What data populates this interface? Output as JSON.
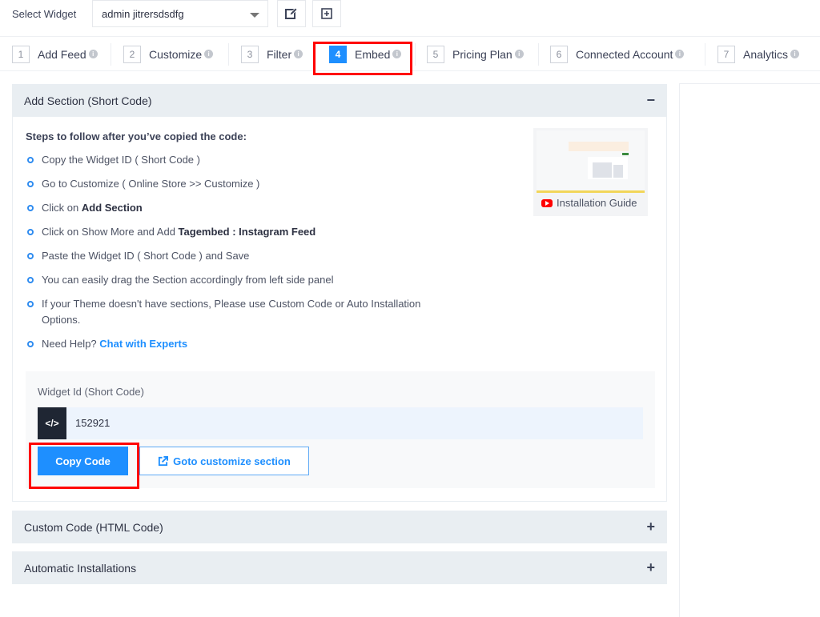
{
  "topbar": {
    "label": "Select Widget",
    "selected_widget": "admin jitrersdsdfg",
    "edit_icon": "edit-icon",
    "add_icon": "plus-square-icon"
  },
  "tabs": [
    {
      "num": "1",
      "label": "Add Feed",
      "active": false
    },
    {
      "num": "2",
      "label": "Customize",
      "active": false
    },
    {
      "num": "3",
      "label": "Filter",
      "active": false
    },
    {
      "num": "4",
      "label": "Embed",
      "active": true
    },
    {
      "num": "5",
      "label": "Pricing Plan",
      "active": false
    },
    {
      "num": "6",
      "label": "Connected Account",
      "active": false
    },
    {
      "num": "7",
      "label": "Analytics",
      "active": false
    }
  ],
  "info_glyph": "i",
  "sections": {
    "add_section": {
      "title": "Add Section (Short Code)",
      "toggle": "−",
      "steps_title": "Steps to follow after you’ve copied the code:",
      "steps": [
        {
          "text": "Copy the Widget ID ( Short Code )"
        },
        {
          "text": "Go to Customize ( Online Store >> Customize )"
        },
        {
          "pre": "Click on ",
          "bold": "Add Section"
        },
        {
          "pre": "Click on Show More and Add ",
          "bold": "Tagembed : Instagram Feed"
        },
        {
          "text": "Paste the Widget ID ( Short Code ) and Save"
        },
        {
          "text": "You can easily drag the Section accordingly from left side panel"
        },
        {
          "text": "If your Theme doesn't have sections, Please use Custom Code or Auto Installation Options."
        },
        {
          "pre": "Need Help? ",
          "link": "Chat with Experts"
        }
      ],
      "guide_label": "Installation Guide",
      "widget_id_label": "Widget Id (Short Code)",
      "code_icon": "</>",
      "widget_id": "152921",
      "copy_button": "Copy Code",
      "goto_button": "Goto customize section"
    },
    "custom_code": {
      "title": "Custom Code (HTML Code)",
      "toggle": "+"
    },
    "automatic": {
      "title": "Automatic Installations",
      "toggle": "+"
    }
  },
  "colors": {
    "accent": "#1e8fff",
    "highlight": "#ff0000",
    "panel_header": "#e9eef2",
    "code_icon_bg": "#1f2633"
  }
}
